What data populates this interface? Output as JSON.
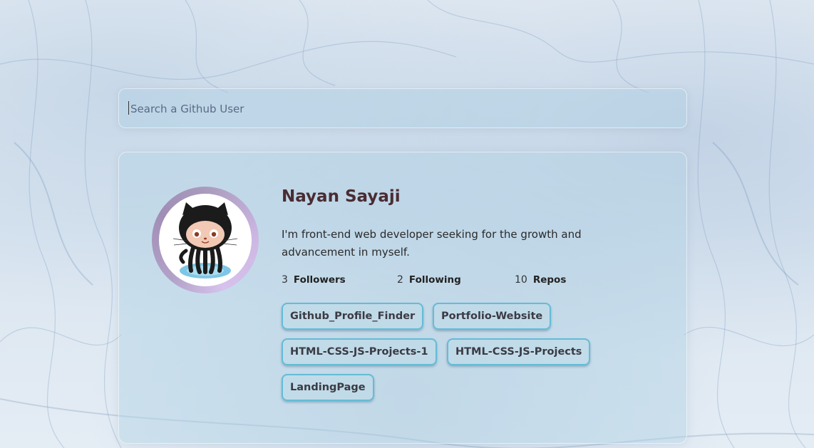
{
  "search": {
    "placeholder": "Search a Github User",
    "value": ""
  },
  "profile": {
    "name": "Nayan Sayaji",
    "bio": " I'm front-end web developer seeking for the growth and advancement in myself.",
    "avatar_icon": "github-octocat-icon",
    "stats": {
      "followers_count": "3",
      "followers_label": "Followers",
      "following_count": "2",
      "following_label": "Following",
      "repos_count": "10",
      "repos_label": "Repos"
    },
    "repos": [
      "Github_Profile_Finder",
      "Portfolio-Website",
      "HTML-CSS-JS-Projects-1",
      "HTML-CSS-JS-Projects",
      "LandingPage"
    ]
  },
  "colors": {
    "accent_border": "#64bcd6",
    "name_color": "#4a2c33",
    "avatar_ring": "#cdb8e4"
  }
}
